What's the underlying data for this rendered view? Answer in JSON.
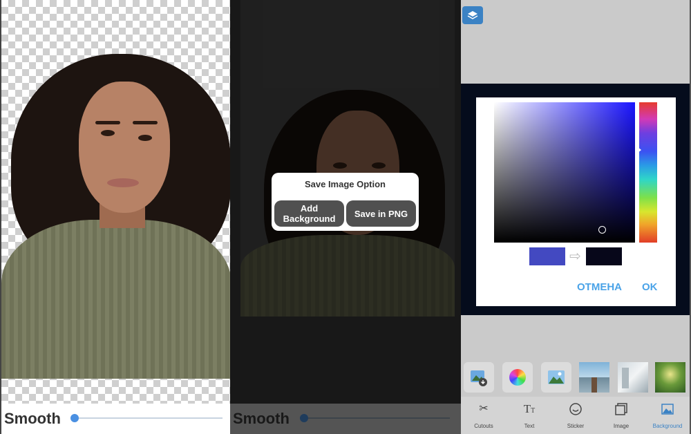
{
  "panel_left": {
    "slider": {
      "label": "Smooth",
      "value": 0.0
    }
  },
  "panel_middle": {
    "slider": {
      "label": "Smooth",
      "value": 0.0
    },
    "dialog": {
      "title": "Save Image Option",
      "add_background_label": "Add\nBackground",
      "save_png_label": "Save in PNG"
    }
  },
  "panel_right": {
    "color_picker": {
      "hue_color": "#1a14ff",
      "old_color": "#4349c1",
      "new_color": "#07071a",
      "cancel_label": "ОТМЕНА",
      "ok_label": "OK"
    },
    "toolbar": {
      "items": [
        {
          "label": "Cutouts",
          "icon": "scissors-icon"
        },
        {
          "label": "Text",
          "icon": "text-icon"
        },
        {
          "label": "Sticker",
          "icon": "sticker-icon"
        },
        {
          "label": "Image",
          "icon": "image-icon"
        },
        {
          "label": "Background",
          "icon": "background-icon"
        }
      ],
      "active": "Background"
    }
  },
  "colors": {
    "accent": "#4a90e2",
    "dialog_button": "#505050",
    "picker_button_text": "#4aa3e8"
  }
}
